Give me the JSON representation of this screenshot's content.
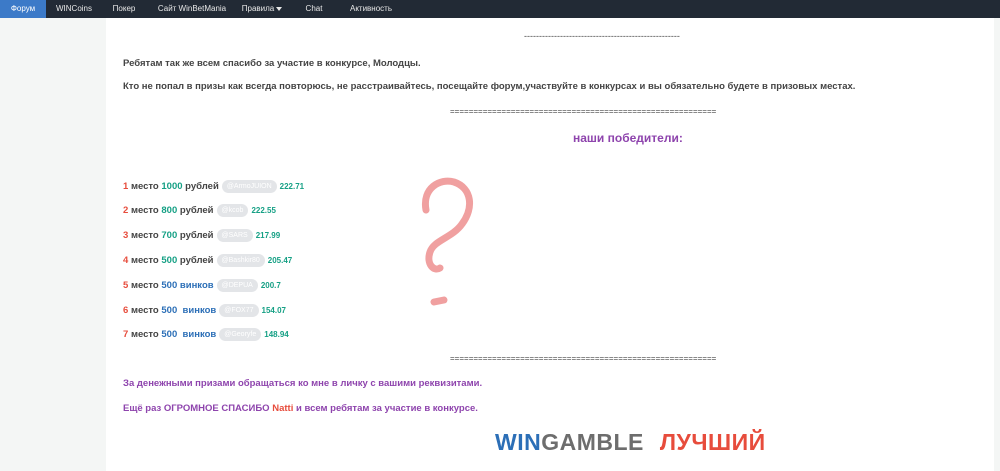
{
  "nav": {
    "items": [
      "Форум",
      "WINCoins",
      "Покер",
      "Сайт WinBetMania",
      "Правила",
      "Chat",
      "Активность"
    ]
  },
  "post": {
    "separator_dash": "----------------------------------------------------",
    "thanks_line": "Ребятам так же всем спасибо за участие в конкурсе,  Молодцы.",
    "consolation_line": "Кто не попал в призы как всегда повторюсь, не расстраивайтесь, посещайте форум,участвуйте в конкурсах и вы обязательно будете в призовых местах.",
    "separator_eq_top": "=========================================================",
    "winners_title": "наши победители:",
    "winners": [
      {
        "place": "1",
        "mesto": "место",
        "amount": "1000",
        "unit": "рублей",
        "user": "@ArmoJUION",
        "score": "222.71",
        "kind": "rub"
      },
      {
        "place": "2",
        "mesto": "место",
        "amount": "800",
        "unit": "рублей",
        "user": "@kcob",
        "score": "222.55",
        "kind": "rub"
      },
      {
        "place": "3",
        "mesto": "место",
        "amount": "700",
        "unit": "рублей",
        "user": "@SARS",
        "score": "217.99",
        "kind": "rub"
      },
      {
        "place": "4",
        "mesto": "место",
        "amount": "500",
        "unit": "рублей",
        "user": "@Bashkir80",
        "score": "205.47",
        "kind": "rub"
      },
      {
        "place": "5",
        "mesto": "место",
        "amount": "500",
        "unit": "винков",
        "user": "@DEPUA",
        "score": "200.7",
        "kind": "wink"
      },
      {
        "place": "6",
        "mesto": "место",
        "amount": "500",
        "unit": "винков",
        "user": "@FOX77",
        "score": "154.07",
        "kind": "wink"
      },
      {
        "place": "7",
        "mesto": "место",
        "amount": "500",
        "unit": "винков",
        "user": "@Georyfe",
        "score": "148.94",
        "kind": "wink"
      }
    ],
    "separator_eq_bottom": "=========================================================",
    "contact_line": "За денежными призами обращаться ко мне в личку с вашими реквизитами.",
    "final_thanks_pre": "Ещё раз ОГРОМНОЕ СПАСИБО",
    "final_thanks_name": "Natti",
    "final_thanks_post": "и всем ребятам за участие в конкурсе.",
    "logo_win": "WIN",
    "logo_gamble": "GAMBLE",
    "logo_best": "ЛУЧШИЙ"
  },
  "colors": {
    "navbar": "#222a35",
    "nav_active": "#3c7ac8",
    "place_red": "#e74c3c",
    "money_green": "#16a085",
    "wink_blue": "#2c6fb7",
    "purple": "#8e44ad",
    "question_mark": "#f0a0a0"
  }
}
